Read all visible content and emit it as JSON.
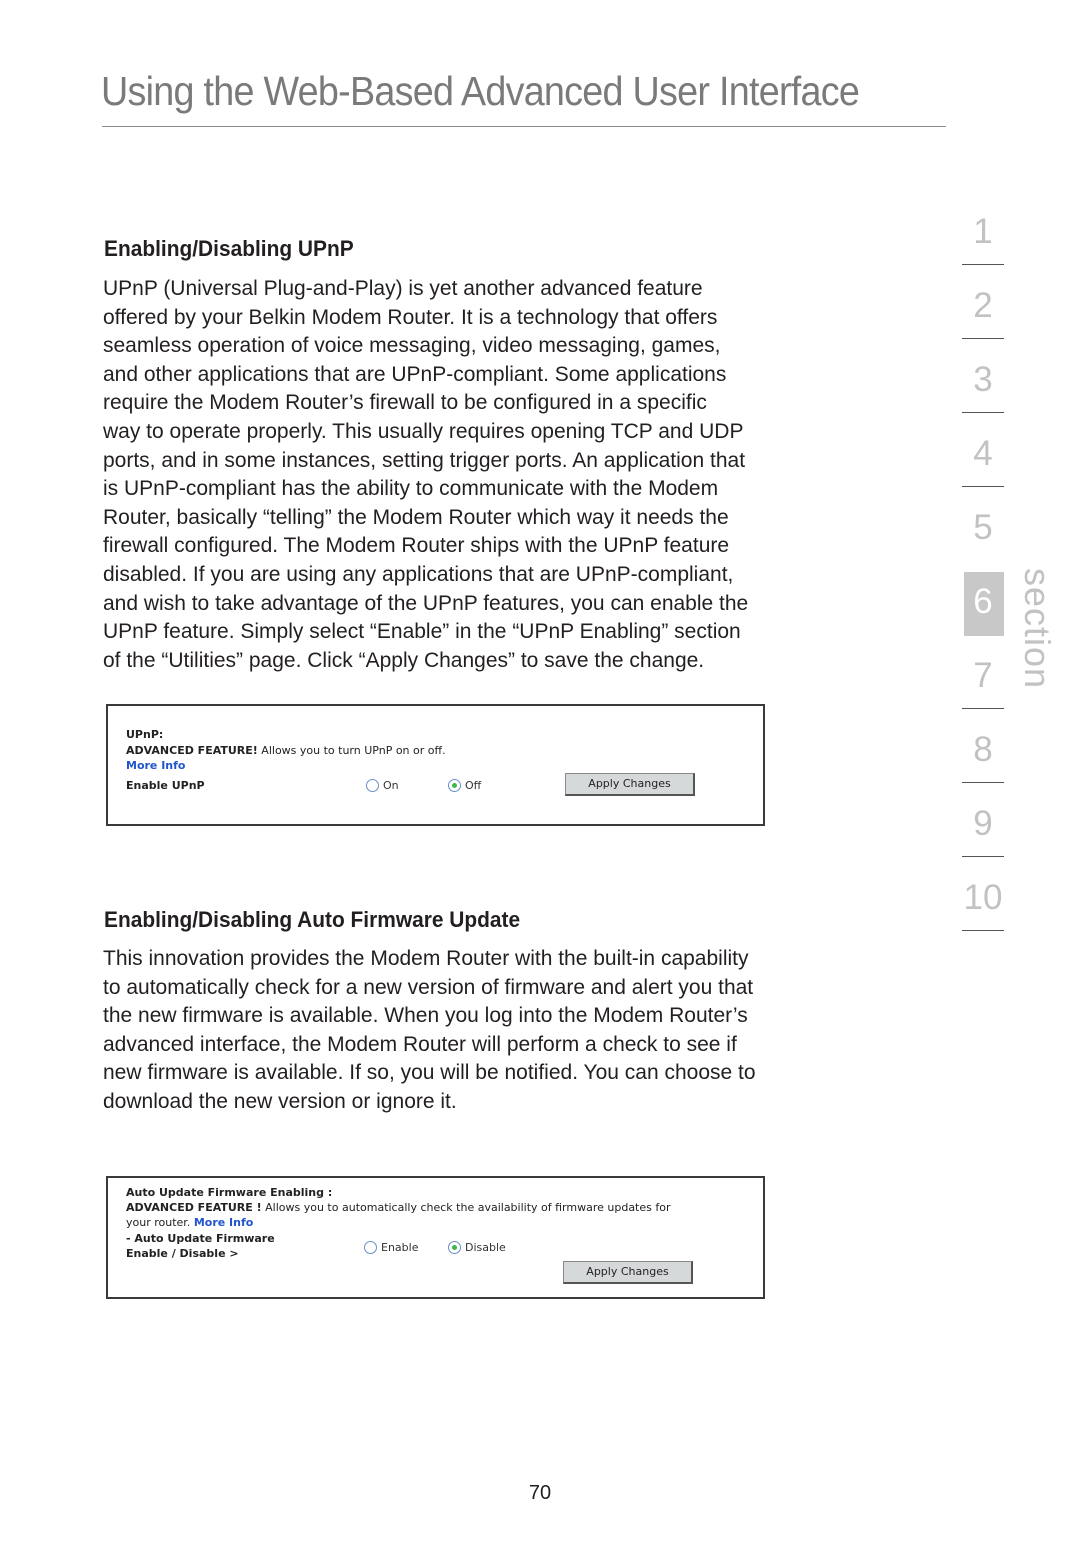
{
  "header": {
    "title": "Using the Web-Based Advanced User Interface"
  },
  "sections": [
    {
      "heading": "Enabling/Disabling UPnP",
      "lines": [
        "UPnP (Universal Plug-and-Play) is yet another advanced feature",
        "offered by your Belkin Modem Router. It is a technology that offers",
        "seamless operation of voice messaging, video messaging, games,",
        "and other applications that are UPnP-compliant. Some applications",
        "require the Modem Router’s firewall to be configured in a specific",
        "way to operate properly. This usually requires opening TCP and UDP",
        "ports, and in some instances, setting trigger ports. An application that",
        "is UPnP-compliant has the ability to communicate with the Modem",
        "Router, basically “telling” the Modem Router which way it needs the",
        "firewall configured. The Modem Router ships with the UPnP feature",
        "disabled. If you are using any applications that are UPnP-compliant,",
        "and wish to take advantage of the UPnP features, you can enable the",
        "UPnP feature. Simply select “Enable” in the “UPnP Enabling” section",
        "of the “Utilities” page. Click “Apply Changes” to save the change."
      ]
    },
    {
      "heading": "Enabling/Disabling Auto Firmware Update",
      "lines": [
        "This innovation provides the Modem Router with the built-in capability",
        "to automatically check for a new version of firmware and alert you that",
        "the new firmware is available. When you log into the Modem Router’s",
        "advanced interface, the Modem Router will perform a check to see if",
        "new firmware is available. If so, you will be notified. You can choose to",
        "download the new version or ignore it."
      ]
    }
  ],
  "upnp_panel": {
    "title": "UPnP:",
    "advanced_label": "ADVANCED FEATURE!",
    "advanced_text": " Allows you to turn UPnP on or off.",
    "more_info": "More Info",
    "field_label": "Enable UPnP",
    "options": [
      {
        "label": "On",
        "selected": false
      },
      {
        "label": "Off",
        "selected": true
      }
    ],
    "apply_label": "Apply Changes"
  },
  "firmware_panel": {
    "title": "Auto Update Firmware Enabling :",
    "advanced_label": "ADVANCED FEATURE !",
    "advanced_text": " Allows you to automatically check the availability of firmware updates for",
    "advanced_text2": "your router. ",
    "more_info": "More Info",
    "field_label_1": "- Auto Update Firmware",
    "field_label_2": "Enable / Disable >",
    "options": [
      {
        "label": "Enable",
        "selected": false
      },
      {
        "label": "Disable",
        "selected": true
      }
    ],
    "apply_label": "Apply Changes"
  },
  "section_nav": {
    "label": "section",
    "items": [
      "1",
      "2",
      "3",
      "4",
      "5",
      "6",
      "7",
      "8",
      "9",
      "10"
    ],
    "active": "6"
  },
  "footer": {
    "page_number": "70"
  },
  "colors": {
    "title_gray": "#7a7a7a",
    "nav_gray": "#c2c2c2",
    "nav_active_bg": "#c8c8c8",
    "link_blue": "#2255cc",
    "radio_selected": "#3db84a"
  }
}
